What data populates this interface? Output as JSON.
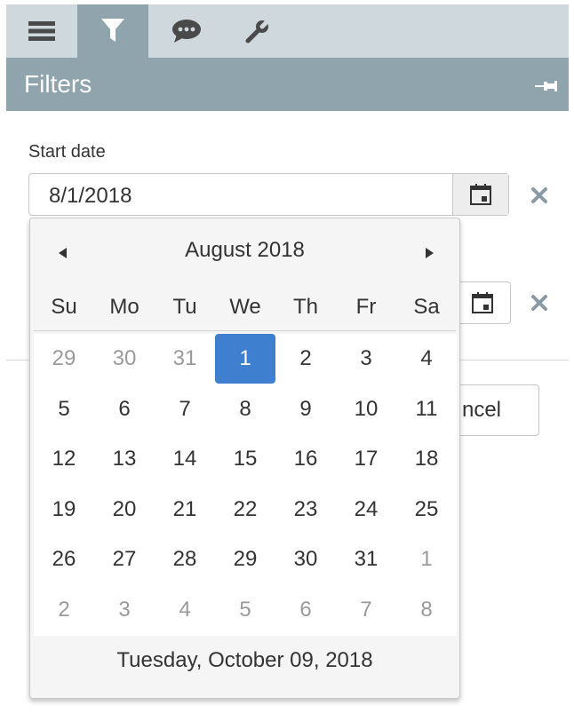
{
  "tabs": [
    {
      "name": "menu",
      "icon": "hamburger-icon"
    },
    {
      "name": "filter",
      "icon": "filter-icon",
      "active": true
    },
    {
      "name": "comments",
      "icon": "speech-bubble-icon"
    },
    {
      "name": "settings",
      "icon": "wrench-icon"
    }
  ],
  "header": {
    "title": "Filters",
    "pin_icon": "pin-icon"
  },
  "start_date": {
    "label": "Start date",
    "value": "8/1/2018"
  },
  "buttons": {
    "cancel_partial": "ncel"
  },
  "calendar": {
    "month_title": "August 2018",
    "weekdays": [
      "Su",
      "Mo",
      "Tu",
      "We",
      "Th",
      "Fr",
      "Sa"
    ],
    "weeks": [
      [
        "29",
        "30",
        "31",
        "1",
        "2",
        "3",
        "4"
      ],
      [
        "5",
        "6",
        "7",
        "8",
        "9",
        "10",
        "11"
      ],
      [
        "12",
        "13",
        "14",
        "15",
        "16",
        "17",
        "18"
      ],
      [
        "19",
        "20",
        "21",
        "22",
        "23",
        "24",
        "25"
      ],
      [
        "26",
        "27",
        "28",
        "29",
        "30",
        "31",
        "1"
      ],
      [
        "2",
        "3",
        "4",
        "5",
        "6",
        "7",
        "8"
      ]
    ],
    "selected_day": "1",
    "footer": "Tuesday, October 09, 2018"
  },
  "colors": {
    "accent": "#3f7fcf",
    "header": "#90a4ae",
    "tabbar": "#cfd8dc"
  }
}
